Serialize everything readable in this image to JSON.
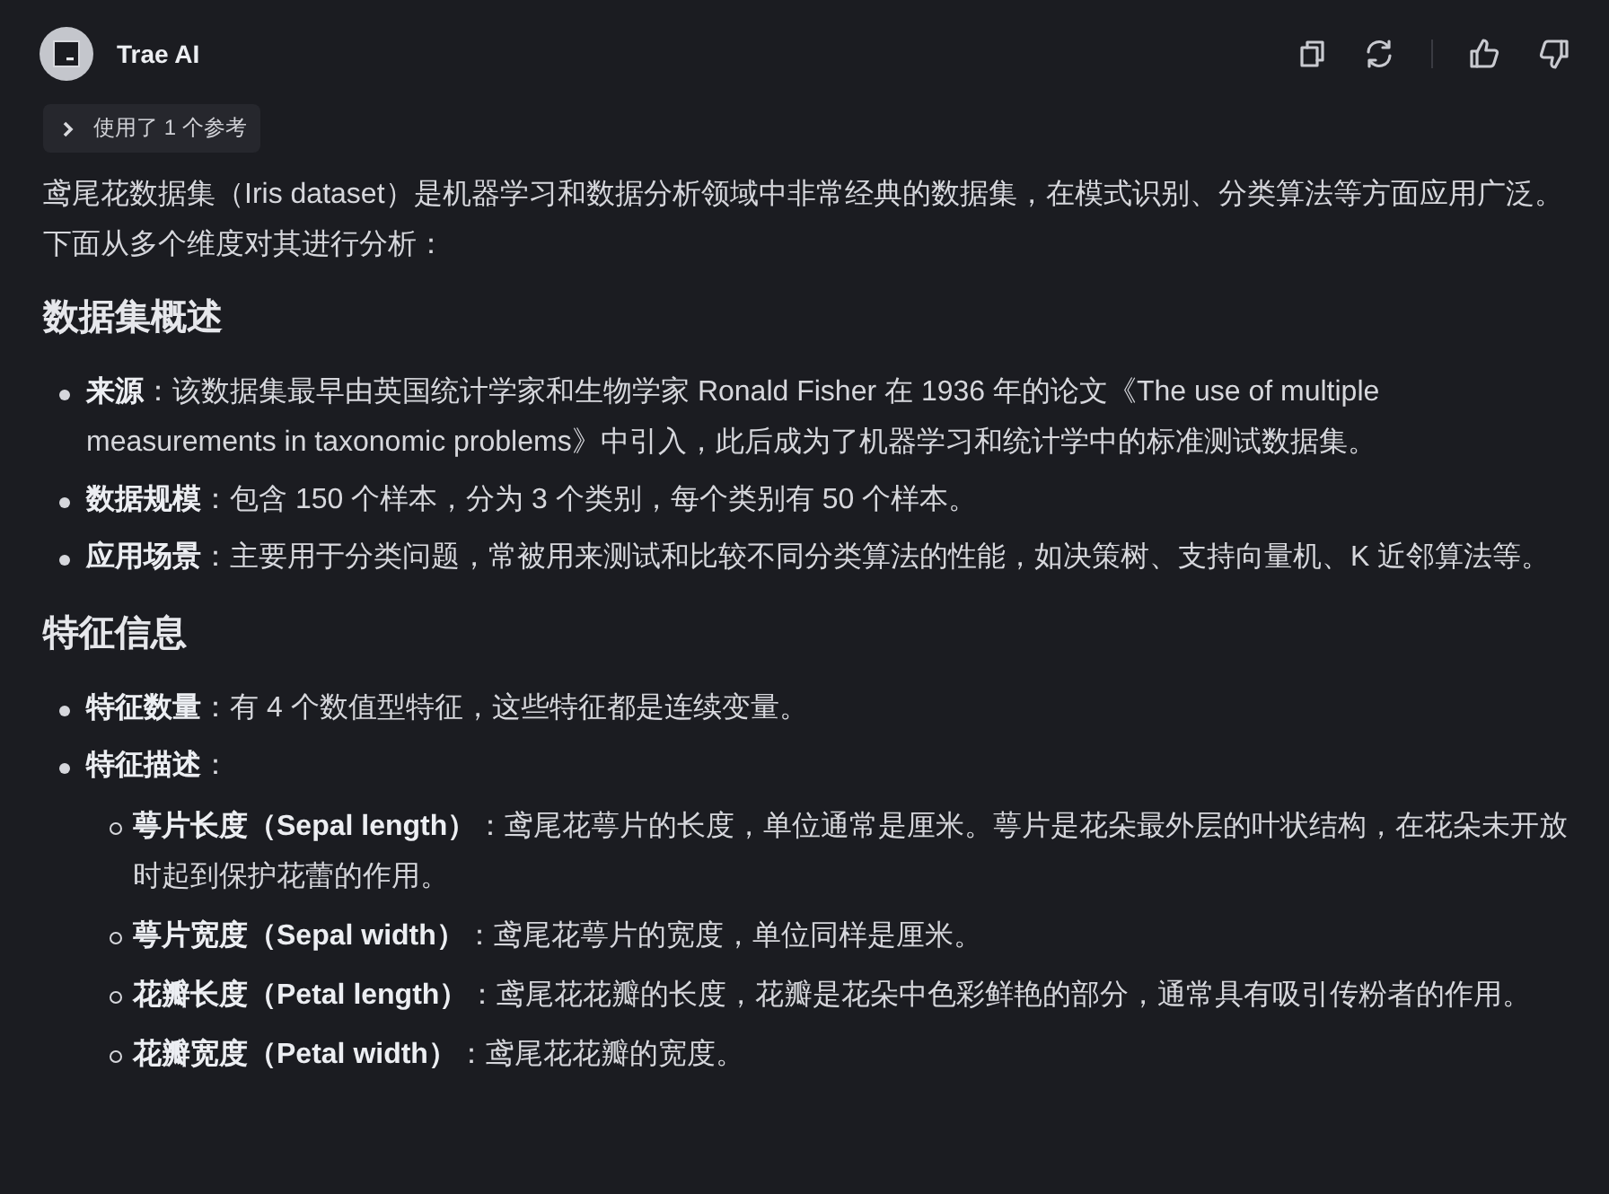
{
  "header": {
    "name": "Trae AI"
  },
  "reference": {
    "label": "使用了 1 个参考",
    "expanded": false
  },
  "intro": "鸢尾花数据集（Iris dataset）是机器学习和数据分析领域中非常经典的数据集，在模式识别、分类算法等方面应用广泛。下面从多个维度对其进行分析：",
  "sections": [
    {
      "heading": "数据集概述",
      "items": [
        {
          "text": "**来源**：该数据集最早由英国统计学家和生物学家 Ronald Fisher 在 1936 年的论文《The use of multiple measurements in taxonomic problems》中引入，此后成为了机器学习和统计学中的标准测试数据集。"
        },
        {
          "text": "**数据规模**：包含 150 个样本，分为 3 个类别，每个类别有 50 个样本。"
        },
        {
          "text": "**应用场景**：主要用于分类问题，常被用来测试和比较不同分类算法的性能，如决策树、支持向量机、K 近邻算法等。"
        }
      ]
    },
    {
      "heading": "特征信息",
      "items": [
        {
          "text": "**特征数量**：有 4 个数值型特征，这些特征都是连续变量。"
        },
        {
          "text": "**特征描述**：",
          "children": [
            {
              "text": "**萼片长度（Sepal length）**：鸢尾花萼片的长度，单位通常是厘米。萼片是花朵最外层的叶状结构，在花朵未开放时起到保护花蕾的作用。"
            },
            {
              "text": "**萼片宽度（Sepal width）**：鸢尾花萼片的宽度，单位同样是厘米。"
            },
            {
              "text": "**花瓣长度（Petal length）**：鸢尾花花瓣的长度，花瓣是花朵中色彩鲜艳的部分，通常具有吸引传粉者的作用。"
            },
            {
              "text": "**花瓣宽度（Petal width）**：鸢尾花花瓣的宽度。"
            }
          ]
        }
      ]
    }
  ]
}
